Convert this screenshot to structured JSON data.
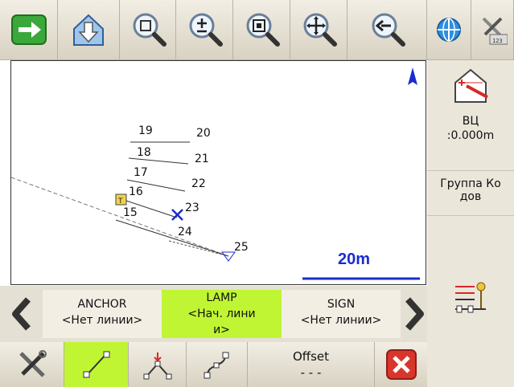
{
  "right_panel": {
    "height_label": "ВЦ",
    "height_value": ":0.000m",
    "group_label": "Группа Ко",
    "group_label2": "дов"
  },
  "map": {
    "scale_text": "20m",
    "point_labels": [
      "19",
      "20",
      "18",
      "21",
      "17",
      "22",
      "16",
      "15",
      "23",
      "24",
      "25"
    ]
  },
  "line_bar": {
    "options": [
      {
        "code": "ANCHOR",
        "status": "<Нет линии>"
      },
      {
        "code": "LAMP",
        "status": "<Нач. лини",
        "status_cut": "и>"
      },
      {
        "code": "SIGN",
        "status": "<Нет линии>"
      }
    ]
  },
  "bottom_bar": {
    "offset_label": "Offset",
    "offset_value": "- - -"
  },
  "colors": {
    "accent_green": "#bff533",
    "marker_blue": "#1a2ccf",
    "close_red": "#d9362b"
  }
}
